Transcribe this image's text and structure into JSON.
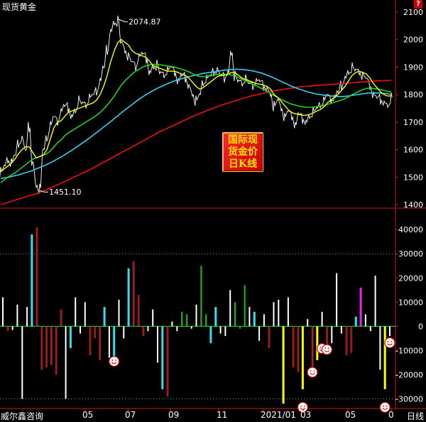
{
  "title": "现货黄金",
  "stamp_lines": [
    "国际现",
    "货金价",
    "日K线"
  ],
  "brand": "威尔鑫咨询",
  "period_label": "日线",
  "help_mark": "?",
  "colors": {
    "background": "#000000",
    "price_line": "#ffffff",
    "ma_fast": "#ffff00",
    "ma_mid": "#22d02a",
    "ma_slow": "#36d0ee",
    "ma_long": "#ee1010",
    "bar_white": "#ffffff",
    "bar_red": "#c81414",
    "bar_green": "#22aa22",
    "bar_cyan": "#33e0ee",
    "bar_yellow": "#ffff00",
    "bar_magenta": "#ee22ee",
    "grid_dotted": "#1cb8c8"
  },
  "chart_data": [
    {
      "type": "line",
      "name": "price",
      "ylim": [
        1400,
        2100
      ],
      "y_ticks": [
        "2100",
        "2000",
        "1900",
        "1800",
        "1700",
        "1600",
        "1500",
        "1400"
      ],
      "x_ticks": [
        "05",
        "07",
        "09",
        "11",
        "2021/01",
        "03",
        "05",
        "0"
      ],
      "annotations": [
        {
          "text": "2074.87",
          "value": 2074.87
        },
        {
          "text": "1451.10",
          "value": 1451.1
        }
      ],
      "price_points": [
        1520,
        1540,
        1560,
        1555,
        1580,
        1620,
        1640,
        1600,
        1680,
        1550,
        1470,
        1460,
        1600,
        1640,
        1690,
        1720,
        1700,
        1740,
        1760,
        1750,
        1720,
        1740,
        1780,
        1770,
        1760,
        1790,
        1800,
        1810,
        1850,
        1900,
        1960,
        2030,
        2060,
        2070,
        1990,
        1960,
        1940,
        1920,
        1900,
        1940,
        1950,
        1930,
        1880,
        1900,
        1910,
        1880,
        1870,
        1890,
        1900,
        1880,
        1850,
        1870,
        1860,
        1830,
        1800,
        1780,
        1800,
        1840,
        1860,
        1870,
        1880,
        1890,
        1870,
        1860,
        1880,
        1950,
        1870,
        1850,
        1840,
        1860,
        1840,
        1830,
        1850,
        1850,
        1830,
        1820,
        1800,
        1760,
        1780,
        1750,
        1720,
        1740,
        1720,
        1690,
        1730,
        1710,
        1700,
        1720,
        1740,
        1750,
        1760,
        1780,
        1800,
        1780,
        1790,
        1810,
        1830,
        1860,
        1880,
        1900,
        1890,
        1880,
        1870,
        1860,
        1830,
        1800,
        1790,
        1780,
        1770,
        1760,
        1790
      ],
      "ma_fast_points": [
        1520,
        1530,
        1540,
        1550,
        1565,
        1585,
        1600,
        1610,
        1610,
        1590,
        1570,
        1575,
        1580,
        1600,
        1640,
        1680,
        1700,
        1705,
        1720,
        1735,
        1740,
        1745,
        1750,
        1755,
        1760,
        1765,
        1770,
        1780,
        1800,
        1830,
        1870,
        1920,
        1960,
        1990,
        2000,
        1990,
        1980,
        1960,
        1950,
        1945,
        1940,
        1935,
        1920,
        1905,
        1900,
        1895,
        1890,
        1885,
        1885,
        1885,
        1880,
        1875,
        1870,
        1860,
        1845,
        1830,
        1820,
        1825,
        1835,
        1845,
        1855,
        1865,
        1870,
        1870,
        1875,
        1880,
        1880,
        1870,
        1860,
        1855,
        1850,
        1845,
        1840,
        1838,
        1835,
        1830,
        1820,
        1800,
        1790,
        1775,
        1760,
        1745,
        1735,
        1730,
        1728,
        1725,
        1725,
        1728,
        1733,
        1740,
        1745,
        1755,
        1770,
        1780,
        1790,
        1800,
        1815,
        1830,
        1850,
        1870,
        1880,
        1885,
        1880,
        1875,
        1860,
        1840,
        1825,
        1810,
        1800,
        1795,
        1795
      ],
      "ma_mid_points": [
        1480,
        1490,
        1500,
        1508,
        1515,
        1525,
        1535,
        1545,
        1555,
        1565,
        1570,
        1575,
        1580,
        1585,
        1595,
        1610,
        1625,
        1635,
        1650,
        1660,
        1668,
        1676,
        1684,
        1692,
        1700,
        1708,
        1716,
        1725,
        1735,
        1748,
        1762,
        1778,
        1795,
        1815,
        1835,
        1850,
        1862,
        1875,
        1885,
        1892,
        1900,
        1905,
        1908,
        1910,
        1910,
        1908,
        1906,
        1904,
        1902,
        1900,
        1896,
        1892,
        1888,
        1883,
        1876,
        1870,
        1866,
        1865,
        1866,
        1868,
        1871,
        1873,
        1874,
        1874,
        1873,
        1871,
        1868,
        1862,
        1856,
        1850,
        1845,
        1838,
        1832,
        1825,
        1820,
        1812,
        1804,
        1796,
        1790,
        1782,
        1776,
        1770,
        1765,
        1762,
        1758,
        1756,
        1754,
        1754,
        1754,
        1756,
        1758,
        1760,
        1764,
        1768,
        1772,
        1776,
        1780,
        1786,
        1792,
        1800,
        1806,
        1812,
        1818,
        1822,
        1824,
        1822,
        1820,
        1818,
        1815,
        1812,
        1810
      ],
      "ma_slow_points": [
        1495,
        1497,
        1499,
        1502,
        1505,
        1508,
        1512,
        1516,
        1520,
        1524,
        1530,
        1535,
        1540,
        1546,
        1552,
        1559,
        1566,
        1573,
        1581,
        1589,
        1597,
        1606,
        1615,
        1624,
        1633,
        1642,
        1652,
        1662,
        1672,
        1682,
        1692,
        1702,
        1713,
        1723,
        1734,
        1744,
        1754,
        1764,
        1774,
        1783,
        1792,
        1800,
        1808,
        1815,
        1822,
        1828,
        1834,
        1840,
        1845,
        1850,
        1854,
        1858,
        1862,
        1865,
        1868,
        1871,
        1874,
        1877,
        1879,
        1881,
        1883,
        1885,
        1887,
        1889,
        1890,
        1891,
        1892,
        1892,
        1891,
        1890,
        1888,
        1886,
        1883,
        1880,
        1876,
        1871,
        1866,
        1860,
        1854,
        1848,
        1842,
        1836,
        1830,
        1825,
        1820,
        1816,
        1812,
        1808,
        1805,
        1802,
        1800,
        1798,
        1796,
        1795,
        1794,
        1793,
        1793,
        1794,
        1795,
        1797,
        1799,
        1801,
        1803,
        1805,
        1806,
        1806,
        1806,
        1805,
        1804,
        1803,
        1802
      ],
      "ma_long_points": [
        1400,
        1404,
        1408,
        1412,
        1416,
        1420,
        1424,
        1428,
        1432,
        1436,
        1440,
        1445,
        1450,
        1455,
        1460,
        1466,
        1472,
        1478,
        1484,
        1490,
        1496,
        1502,
        1508,
        1514,
        1520,
        1526,
        1533,
        1540,
        1547,
        1554,
        1561,
        1568,
        1575,
        1582,
        1589,
        1596,
        1603,
        1610,
        1617,
        1624,
        1631,
        1638,
        1645,
        1652,
        1659,
        1666,
        1672,
        1678,
        1684,
        1690,
        1696,
        1702,
        1708,
        1714,
        1720,
        1726,
        1731,
        1736,
        1741,
        1746,
        1751,
        1756,
        1761,
        1765,
        1769,
        1773,
        1777,
        1781,
        1785,
        1789,
        1793,
        1796,
        1799,
        1802,
        1805,
        1808,
        1811,
        1814,
        1816,
        1818,
        1820,
        1822,
        1824,
        1826,
        1828,
        1829,
        1830,
        1831,
        1832,
        1833,
        1834,
        1835,
        1836,
        1837,
        1838,
        1839,
        1840,
        1841,
        1842,
        1843,
        1844,
        1845,
        1846,
        1847,
        1848,
        1849,
        1850,
        1850,
        1851,
        1851,
        1852
      ]
    },
    {
      "type": "bar",
      "name": "position_change",
      "ylim": [
        -34000,
        48000
      ],
      "y_ticks": [
        "40000",
        "30000",
        "20000",
        "10000",
        "0",
        "-10000",
        "-20000",
        "-30000"
      ],
      "reference_lines": [
        30000,
        -30000
      ],
      "bars": [
        {
          "v": 12000,
          "c": "white"
        },
        {
          "v": -2000,
          "c": "red"
        },
        {
          "v": -1500,
          "c": "white"
        },
        {
          "v": 9000,
          "c": "white"
        },
        {
          "v": -30000,
          "c": "white"
        },
        {
          "v": 8000,
          "c": "white"
        },
        {
          "v": 38000,
          "c": "cyan"
        },
        {
          "v": 41000,
          "c": "red"
        },
        {
          "v": -18000,
          "c": "red"
        },
        {
          "v": -17000,
          "c": "red"
        },
        {
          "v": -16000,
          "c": "red"
        },
        {
          "v": -20000,
          "c": "red"
        },
        {
          "v": 7000,
          "c": "red"
        },
        {
          "v": -30000,
          "c": "white"
        },
        {
          "v": -9000,
          "c": "cyan"
        },
        {
          "v": 12000,
          "c": "white"
        },
        {
          "v": -3000,
          "c": "white"
        },
        {
          "v": 10000,
          "c": "white"
        },
        {
          "v": -12000,
          "c": "red"
        },
        {
          "v": -5000,
          "c": "red"
        },
        {
          "v": -14000,
          "c": "red"
        },
        {
          "v": 8000,
          "c": "cyan"
        },
        {
          "v": -13000,
          "c": "white"
        },
        {
          "v": -16000,
          "c": "cyan"
        },
        {
          "v": 11000,
          "c": "white"
        },
        {
          "v": -5000,
          "c": "white"
        },
        {
          "v": 24000,
          "c": "cyan"
        },
        {
          "v": 27000,
          "c": "red"
        },
        {
          "v": 13000,
          "c": "red"
        },
        {
          "v": -4000,
          "c": "red"
        },
        {
          "v": -2000,
          "c": "white"
        },
        {
          "v": 7000,
          "c": "white"
        },
        {
          "v": -15000,
          "c": "white"
        },
        {
          "v": -26000,
          "c": "cyan"
        },
        {
          "v": -29000,
          "c": "red"
        },
        {
          "v": 2000,
          "c": "white"
        },
        {
          "v": -2000,
          "c": "white"
        },
        {
          "v": 6000,
          "c": "green"
        },
        {
          "v": 5000,
          "c": "green"
        },
        {
          "v": -1000,
          "c": "white"
        },
        {
          "v": 9000,
          "c": "white"
        },
        {
          "v": 25000,
          "c": "green"
        },
        {
          "v": 5000,
          "c": "green"
        },
        {
          "v": -7000,
          "c": "cyan"
        },
        {
          "v": 8000,
          "c": "cyan"
        },
        {
          "v": -3000,
          "c": "white"
        },
        {
          "v": -4000,
          "c": "white"
        },
        {
          "v": 15000,
          "c": "white"
        },
        {
          "v": 10000,
          "c": "green"
        },
        {
          "v": -1000,
          "c": "green"
        },
        {
          "v": 17000,
          "c": "green"
        },
        {
          "v": 8000,
          "c": "white"
        },
        {
          "v": 6000,
          "c": "cyan"
        },
        {
          "v": -6000,
          "c": "white"
        },
        {
          "v": 5000,
          "c": "white"
        },
        {
          "v": -9000,
          "c": "red"
        },
        {
          "v": 10000,
          "c": "white"
        },
        {
          "v": 11000,
          "c": "white"
        },
        {
          "v": -32000,
          "c": "yellow"
        },
        {
          "v": 12000,
          "c": "white"
        },
        {
          "v": -17000,
          "c": "red"
        },
        {
          "v": -19000,
          "c": "red"
        },
        {
          "v": -26000,
          "c": "yellow"
        },
        {
          "v": 3000,
          "c": "white"
        },
        {
          "v": -20000,
          "c": "red"
        },
        {
          "v": -14000,
          "c": "yellow"
        },
        {
          "v": 6000,
          "c": "white"
        },
        {
          "v": -9000,
          "c": "red"
        },
        {
          "v": -7000,
          "c": "white"
        },
        {
          "v": 22000,
          "c": "white"
        },
        {
          "v": -3000,
          "c": "white"
        },
        {
          "v": -12000,
          "c": "red"
        },
        {
          "v": -11000,
          "c": "red"
        },
        {
          "v": 4000,
          "c": "cyan"
        },
        {
          "v": 16000,
          "c": "magenta"
        },
        {
          "v": 5000,
          "c": "white"
        },
        {
          "v": -2000,
          "c": "white"
        },
        {
          "v": 21000,
          "c": "white"
        },
        {
          "v": -18000,
          "c": "white"
        },
        {
          "v": -26000,
          "c": "yellow"
        },
        {
          "v": -4000,
          "c": "white"
        }
      ],
      "smiley_markers": [
        {
          "bar": 23,
          "v": -14500
        },
        {
          "bar": 66,
          "v": -9200
        },
        {
          "bar": 67,
          "v": -9600
        },
        {
          "bar": 64,
          "v": -19000
        },
        {
          "bar": 62,
          "v": -33500
        },
        {
          "bar": 79,
          "v": -33500
        },
        {
          "bar": 80,
          "v": -6800
        }
      ]
    }
  ]
}
